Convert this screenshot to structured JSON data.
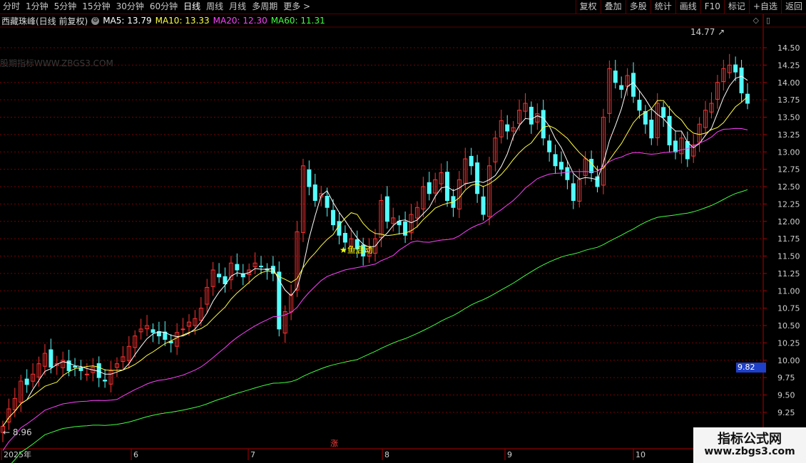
{
  "toolbar": {
    "periods": [
      "分时",
      "1分钟",
      "5分钟",
      "15分钟",
      "30分钟",
      "60分钟",
      "日线",
      "周线",
      "月线",
      "多周期",
      "更多 >"
    ],
    "active_period": "日线",
    "actions": [
      "复权",
      "叠加",
      "多股",
      "统计",
      "画线",
      "F10",
      "标记",
      "+自选",
      "返回"
    ]
  },
  "legend": {
    "title": "西藏珠峰(日线 前复权)",
    "ma5": "MA5: 13.79",
    "ma10": "MA10: 13.33",
    "ma20": "MA20: 12.30",
    "ma60": "MA60: 11.31",
    "colors": {
      "ma5": "#ffffff",
      "ma10": "#ffff40",
      "ma20": "#ff40ff",
      "ma60": "#40ff40"
    }
  },
  "watermark": "股期指标WWW.ZBGS3.COM",
  "annotations": {
    "high": "14.77",
    "low": "8.96",
    "signal": "鱼启动",
    "zhang": "涨"
  },
  "current_price": "9.82",
  "y_axis": [
    "14.50",
    "14.25",
    "14.00",
    "13.75",
    "13.50",
    "13.25",
    "13.00",
    "12.75",
    "12.50",
    "12.25",
    "12.00",
    "11.75",
    "11.50",
    "11.25",
    "11.00",
    "10.75",
    "10.50",
    "10.25",
    "10.00",
    "9.75",
    "9.50",
    "9.25"
  ],
  "x_axis": [
    "2025年",
    "6",
    "7",
    "8",
    "9",
    "10"
  ],
  "badge": {
    "line1": "指标公式网",
    "line2": "www.zbgs3.com"
  },
  "colors": {
    "up": "#ff3232",
    "down": "#54fcfc",
    "grid": "#7a0000",
    "axis": "#b00000"
  }
}
